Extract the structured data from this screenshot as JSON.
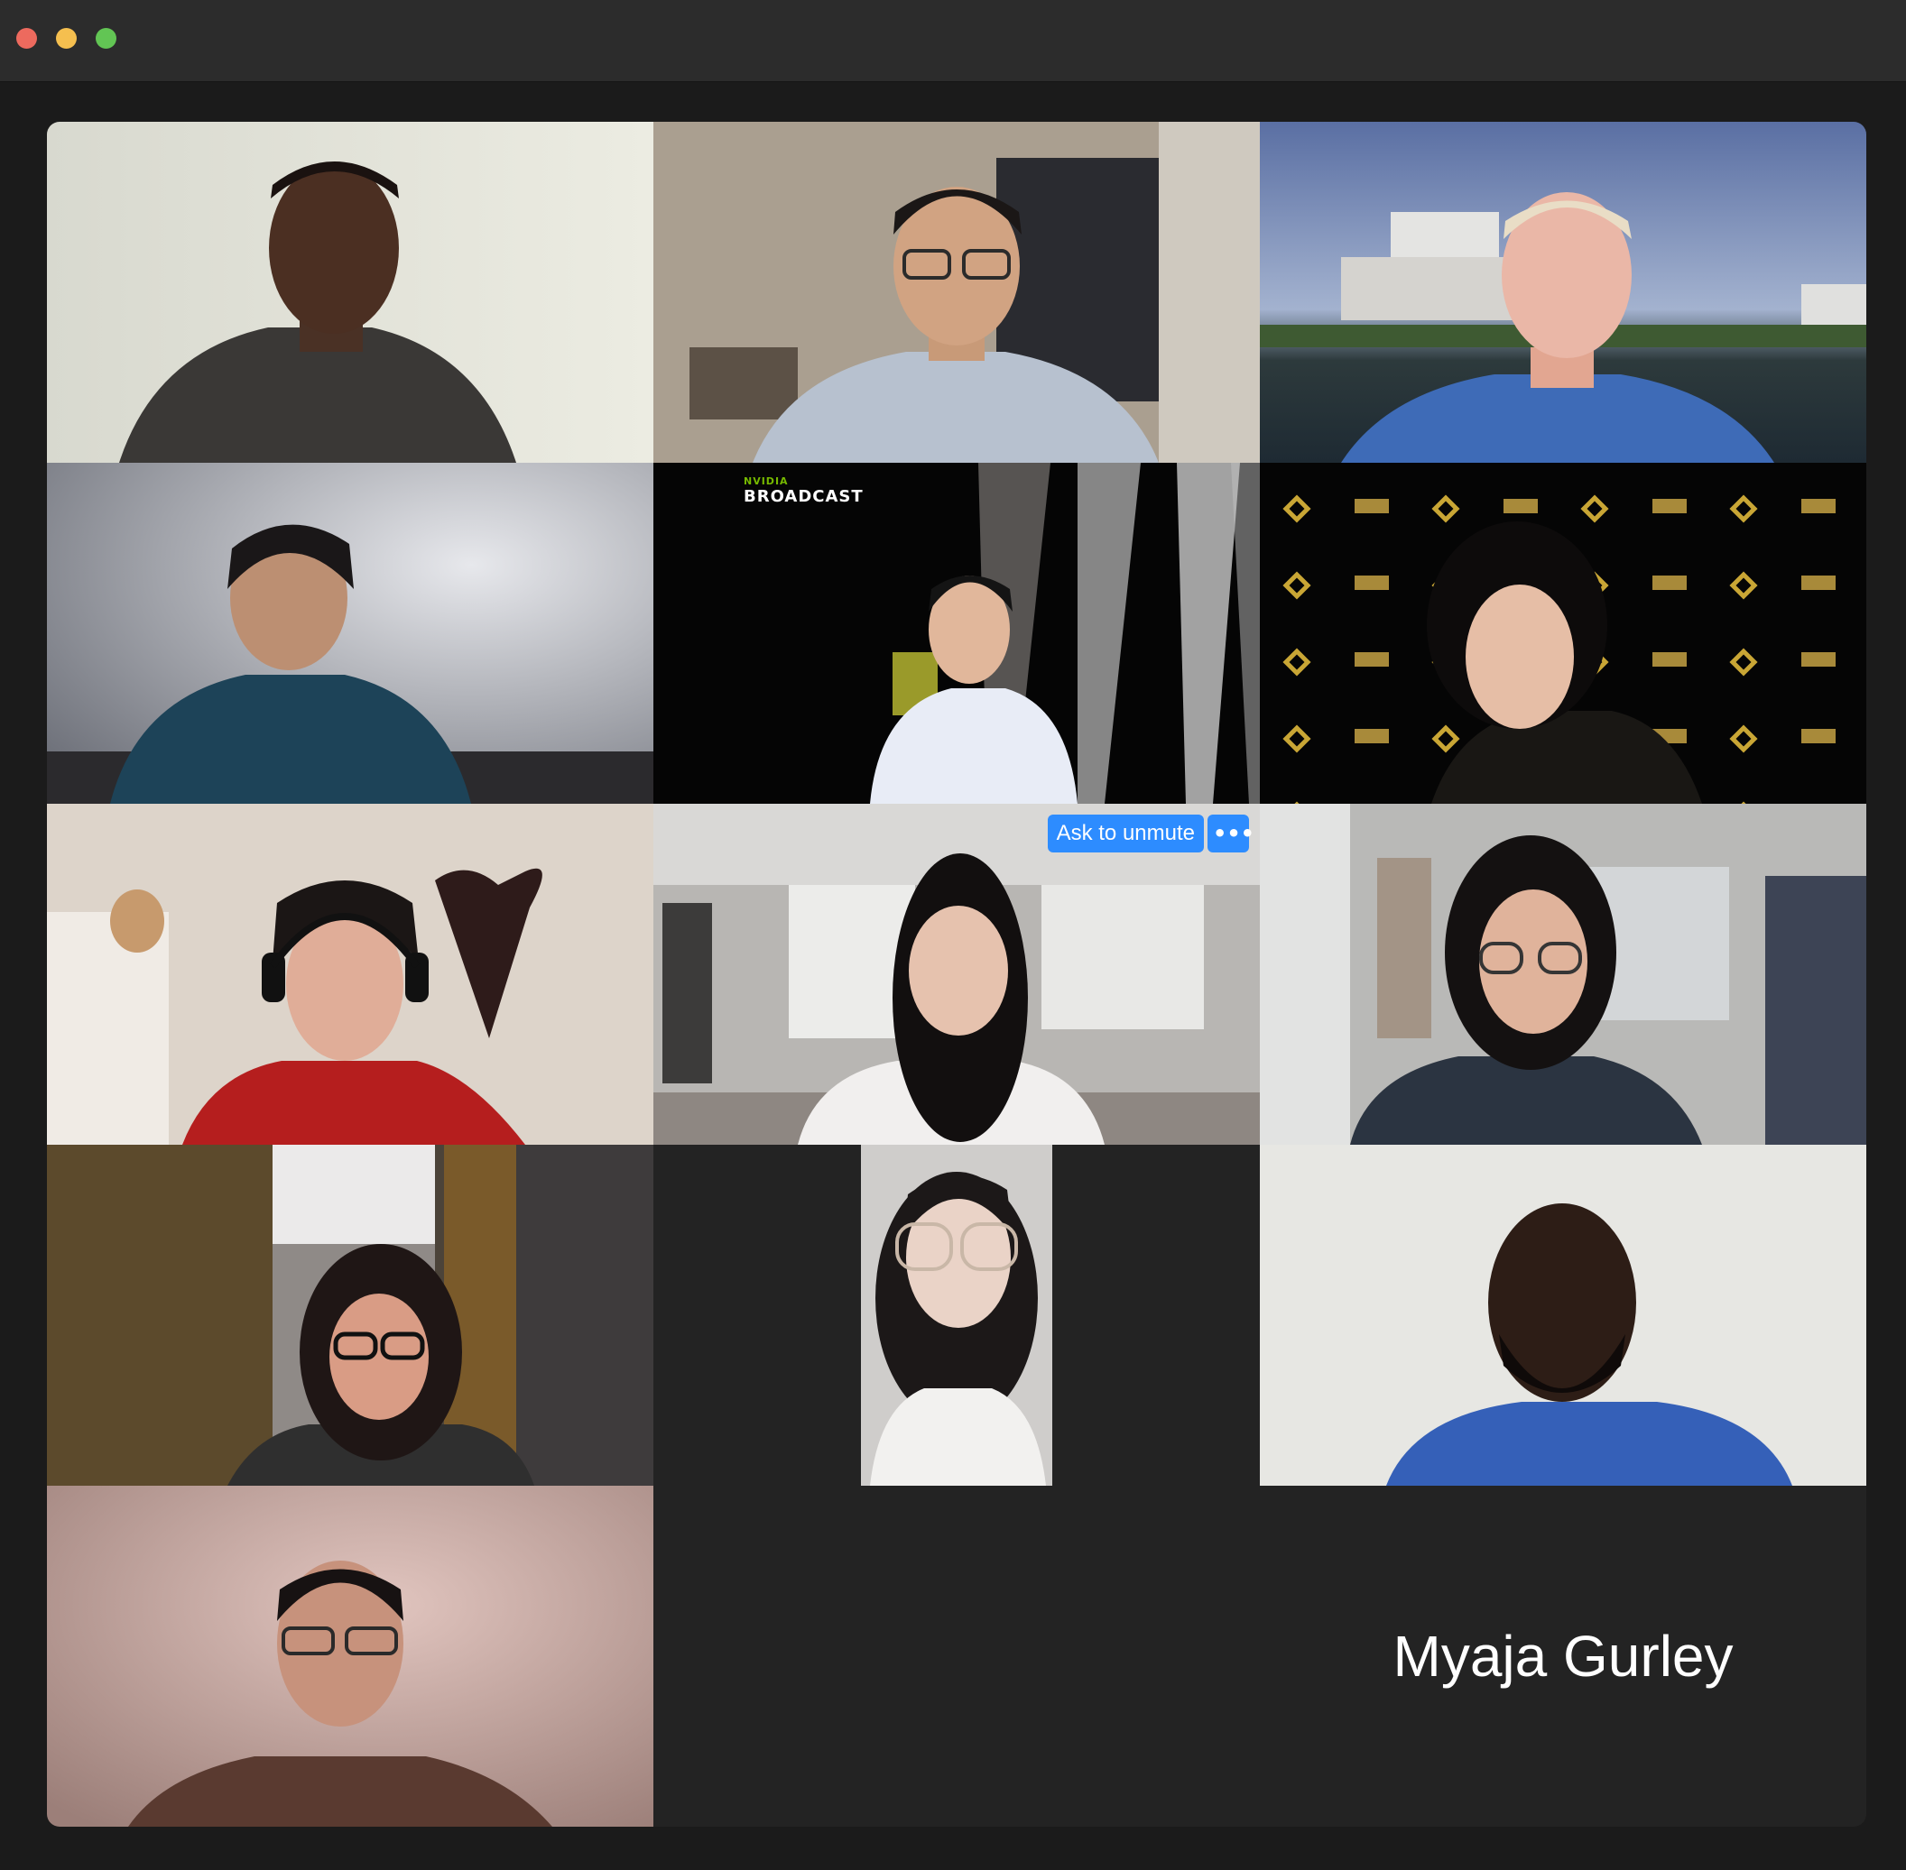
{
  "window": {
    "traffic_lights": {
      "close": "#ed6a5e",
      "minimize": "#f5bf4f",
      "maximize": "#62c554"
    }
  },
  "colors": {
    "background": "#1b1b1b",
    "gallery": "#232323",
    "active_speaker_border": "#5bd35b",
    "button_blue": "#2d8cff"
  },
  "tiles": [
    {
      "kind": "video"
    },
    {
      "kind": "video",
      "active_speaker": true
    },
    {
      "kind": "video"
    },
    {
      "kind": "video"
    },
    {
      "kind": "video",
      "overlay": {
        "brand_small": "NVIDIA",
        "brand_big": "BROADCAST"
      }
    },
    {
      "kind": "video"
    },
    {
      "kind": "video"
    },
    {
      "kind": "video",
      "hover_controls": {
        "ask_to_unmute": "Ask to unmute",
        "more_icon": "ellipsis-icon",
        "more_glyph": "•••"
      }
    },
    {
      "kind": "video"
    },
    {
      "kind": "video"
    },
    {
      "kind": "video",
      "orientation": "portrait"
    },
    {
      "kind": "video"
    },
    {
      "kind": "video"
    },
    {
      "kind": "name-only",
      "name": "Myaja Gurley"
    }
  ]
}
